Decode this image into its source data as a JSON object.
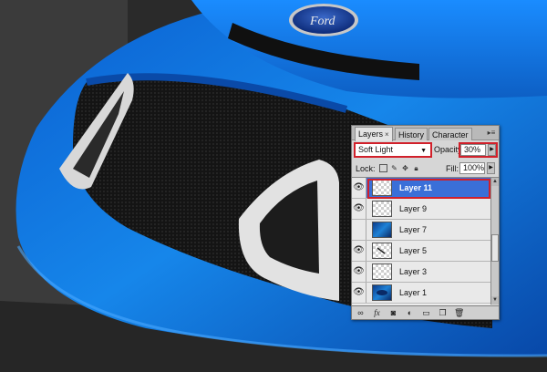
{
  "panel": {
    "tabs": [
      {
        "label": "Layers",
        "close": "×",
        "active": true
      },
      {
        "label": "History",
        "active": false
      },
      {
        "label": "Character",
        "active": false
      }
    ],
    "menu_icon": "panel-menu-icon",
    "blend_mode": "Soft Light",
    "opacity_label": "Opacity:",
    "opacity_value": "30%",
    "lock_label": "Lock:",
    "fill_label": "Fill:",
    "fill_value": "100%",
    "layers": [
      {
        "name": "Layer 11",
        "visible": true,
        "selected": true,
        "thumb": "transparent"
      },
      {
        "name": "Layer 9",
        "visible": true,
        "selected": false,
        "thumb": "transparent"
      },
      {
        "name": "Layer 7",
        "visible": false,
        "selected": false,
        "thumb": "photo"
      },
      {
        "name": "Layer 5",
        "visible": true,
        "selected": false,
        "thumb": "transparent-mark"
      },
      {
        "name": "Layer 3",
        "visible": true,
        "selected": false,
        "thumb": "transparent"
      },
      {
        "name": "Layer 1",
        "visible": true,
        "selected": false,
        "thumb": "photo-car"
      }
    ]
  }
}
